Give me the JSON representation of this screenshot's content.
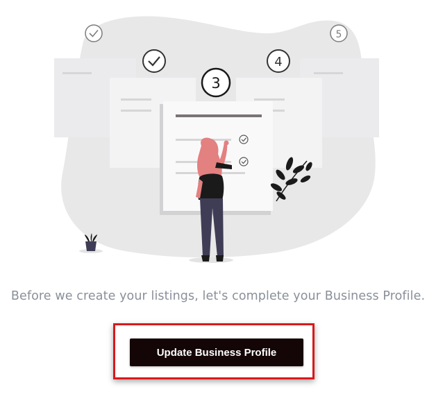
{
  "illustration": {
    "step_numbers": [
      "3",
      "4",
      "5"
    ],
    "completed_steps": 2,
    "colors": {
      "blob": "#e8e8e8",
      "card": "#f7f7f8",
      "card_side": "#ebebed",
      "line": "#d6d6d6",
      "dark_line": "#7a7474",
      "hair": "#e38080",
      "clothing": "#1a1a1a",
      "pants": "#3f3d56"
    }
  },
  "intro": {
    "text": "Before we create your listings, let's complete your Business Profile."
  },
  "cta": {
    "label": "Update Business Profile",
    "background": "#140607",
    "highlight_color": "#d8191b"
  }
}
